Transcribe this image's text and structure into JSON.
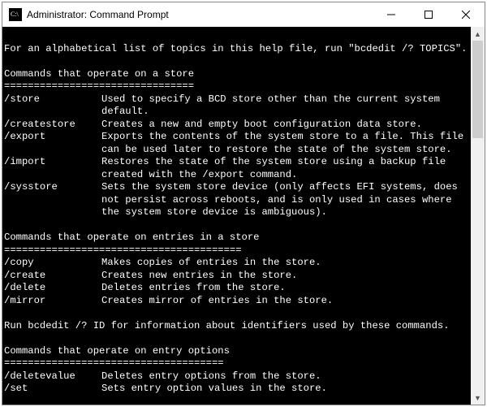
{
  "window": {
    "title": "Administrator: Command Prompt"
  },
  "terminal": {
    "line_intro": "For an alphabetical list of topics in this help file, run \"bcdedit /? TOPICS\".",
    "section1_heading": "Commands that operate on a store",
    "rule": "================================",
    "rule_long": "========================================",
    "rule_mid": "=====================================",
    "store_cmds": [
      {
        "cmd": "/store",
        "desc": "Used to specify a BCD store other than the current system default."
      },
      {
        "cmd": "/createstore",
        "desc": "Creates a new and empty boot configuration data store."
      },
      {
        "cmd": "/export",
        "desc": "Exports the contents of the system store to a file. This file\ncan be used later to restore the state of the system store."
      },
      {
        "cmd": "/import",
        "desc": "Restores the state of the system store using a backup file\ncreated with the /export command."
      },
      {
        "cmd": "/sysstore",
        "desc": "Sets the system store device (only affects EFI systems, does\nnot persist across reboots, and is only used in cases where\nthe system store device is ambiguous)."
      }
    ],
    "section2_heading": "Commands that operate on entries in a store",
    "entry_cmds": [
      {
        "cmd": "/copy",
        "desc": "Makes copies of entries in the store."
      },
      {
        "cmd": "/create",
        "desc": "Creates new entries in the store."
      },
      {
        "cmd": "/delete",
        "desc": "Deletes entries from the store."
      },
      {
        "cmd": "/mirror",
        "desc": "Creates mirror of entries in the store."
      }
    ],
    "line_idinfo": "Run bcdedit /? ID for information about identifiers used by these commands.",
    "section3_heading": "Commands that operate on entry options",
    "option_cmds": [
      {
        "cmd": "/deletevalue",
        "desc": "Deletes entry options from the store."
      },
      {
        "cmd": "/set",
        "desc": "Sets entry option values in the store."
      }
    ]
  }
}
